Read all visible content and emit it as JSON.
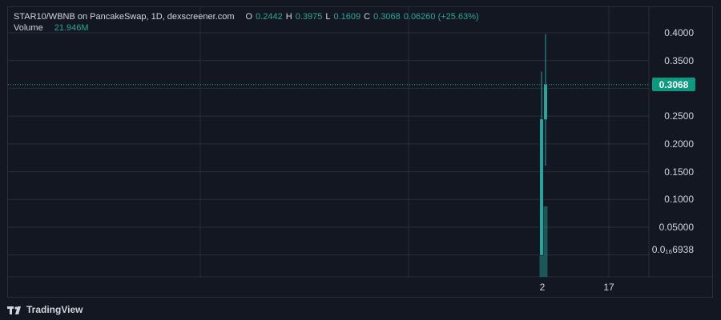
{
  "legend": {
    "title": "STAR10/WBNB on PancakeSwap, 1D, dexscreener.com",
    "o_label": "O",
    "o_value": "0.2442",
    "h_label": "H",
    "h_value": "0.3975",
    "l_label": "L",
    "l_value": "0.1609",
    "c_label": "C",
    "c_value": "0.3068",
    "change": "0.06260 (+25.63%)",
    "volume_label": "Volume",
    "volume_value": "21.946M"
  },
  "price_badge": "0.3068",
  "brand": "TradingView",
  "colors": {
    "background": "#131722",
    "grid": "#2a2e39",
    "up": "#26a69a",
    "badge": "#089981",
    "text": "#d1d4dc"
  },
  "chart_data": {
    "type": "candlestick",
    "y_tick_labels": [
      "0.4000",
      "0.3500",
      "0.3068",
      "0.2500",
      "0.2000",
      "0.1500",
      "0.1000",
      "0.05000",
      "0.0₁₆6938"
    ],
    "x_tick_labels": [
      "2",
      "17"
    ],
    "ylim": [
      0,
      0.42
    ],
    "current_price": 0.3068,
    "candles": [
      {
        "x": "1",
        "open": 0.0,
        "high": 0.33,
        "low": 0.0,
        "close": 0.2442,
        "volume_level": 0.3
      },
      {
        "x": "2",
        "open": 0.2442,
        "high": 0.3975,
        "low": 0.1609,
        "close": 0.3068,
        "volume_level": 1.0
      }
    ]
  }
}
